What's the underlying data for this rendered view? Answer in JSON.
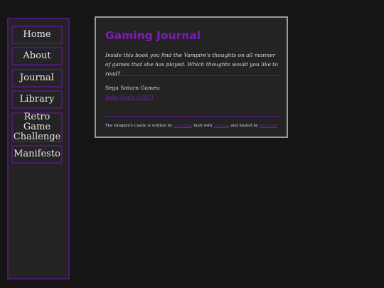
{
  "nav": [
    "Home",
    "About",
    "Journal",
    "Library",
    "Retro Game Challenge",
    "Manifesto"
  ],
  "main": {
    "title": "Gaming Journal",
    "intro": "Inside this book you find the Vampire's thoughts on all manner of games that she has played. Which thoughts would you like to read?",
    "section_label": "Sega Saturn Games:",
    "games": [
      "Bulk Slash (1997)"
    ]
  },
  "footer": {
    "text1": "The Vampire's Castle is written by ",
    "author": "Christina",
    "text2": ", built with ",
    "builder": "Sunrise",
    "text3": ", and hosted by ",
    "host": "Neocities"
  },
  "colors": {
    "accent": "#7b1fb4",
    "border": "#4e1a6e",
    "background": "#151515"
  }
}
